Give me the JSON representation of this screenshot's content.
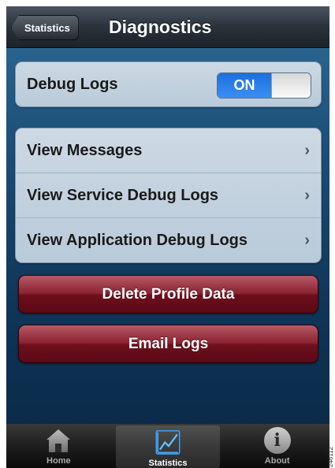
{
  "navbar": {
    "back_label": "Statistics",
    "title": "Diagnostics"
  },
  "debug": {
    "label": "Debug Logs",
    "toggle_state": "ON"
  },
  "menu": {
    "items": [
      {
        "label": "View Messages"
      },
      {
        "label": "View Service Debug Logs"
      },
      {
        "label": "View Application Debug Logs"
      }
    ]
  },
  "actions": {
    "delete_label": "Delete Profile Data",
    "email_label": "Email Logs"
  },
  "tabs": {
    "items": [
      {
        "label": "Home",
        "icon": "home-icon"
      },
      {
        "label": "Statistics",
        "icon": "statistics-chart-icon",
        "active": true
      },
      {
        "label": "About",
        "icon": "info-icon"
      }
    ]
  },
  "figure_id": "246112",
  "colors": {
    "toggle_on": "#2a7fe8",
    "danger": "#7a1424",
    "nav": "#2a323b"
  }
}
